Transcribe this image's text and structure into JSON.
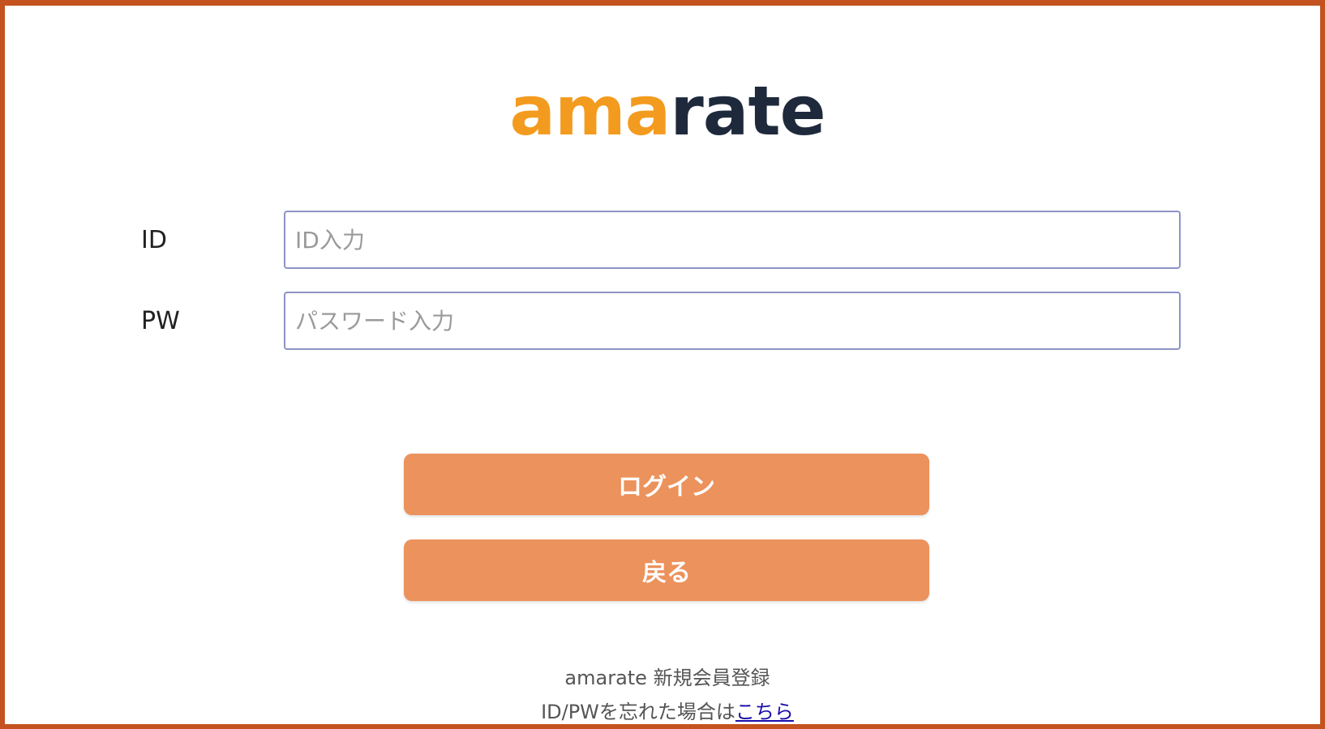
{
  "logo": {
    "part_a": "ama",
    "part_b": "rate"
  },
  "form": {
    "id_label": "ID",
    "id_placeholder": "ID入力",
    "pw_label": "PW",
    "pw_placeholder": "パスワード入力"
  },
  "buttons": {
    "login": "ログイン",
    "back": "戻る"
  },
  "footer": {
    "register_text": "amarate 新規会員登録",
    "forgot_text": "ID/PWを忘れた場合は",
    "forgot_link": "こちら"
  },
  "colors": {
    "logo_orange": "#f39b1e",
    "logo_navy": "#1e2a3c",
    "button_orange": "#ec925c",
    "frame_border": "#c4531f",
    "input_border": "#8d93c6",
    "link": "#1a0dab"
  }
}
